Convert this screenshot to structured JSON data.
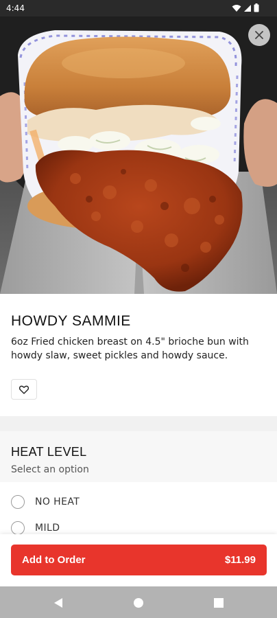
{
  "status_bar": {
    "time": "4:44",
    "icons": [
      "wifi-icon",
      "signal-icon",
      "battery-icon"
    ]
  },
  "hero": {
    "image": "fried-chicken-sandwich-photo",
    "close_icon": "close-icon"
  },
  "item": {
    "title": "HOWDY SAMMIE",
    "description": "6oz Fried chicken breast on 4.5\" brioche bun with howdy slaw, sweet pickles and howdy sauce.",
    "favorite_icon": "heart-outline-icon"
  },
  "heat_level": {
    "title": "HEAT LEVEL",
    "subtitle": "Select an option",
    "options": [
      {
        "label": "NO HEAT",
        "selected": false
      },
      {
        "label": "MILD",
        "selected": false
      }
    ]
  },
  "order_bar": {
    "button_label": "Add to Order",
    "price": "$11.99"
  },
  "nav_bar": {
    "buttons": [
      "back-icon",
      "home-icon",
      "recents-icon"
    ]
  },
  "colors": {
    "accent": "#e8352c",
    "status_bar": "#2a2a2a",
    "nav_bar": "#b3b3b3",
    "section_bg": "#f7f7f7"
  }
}
